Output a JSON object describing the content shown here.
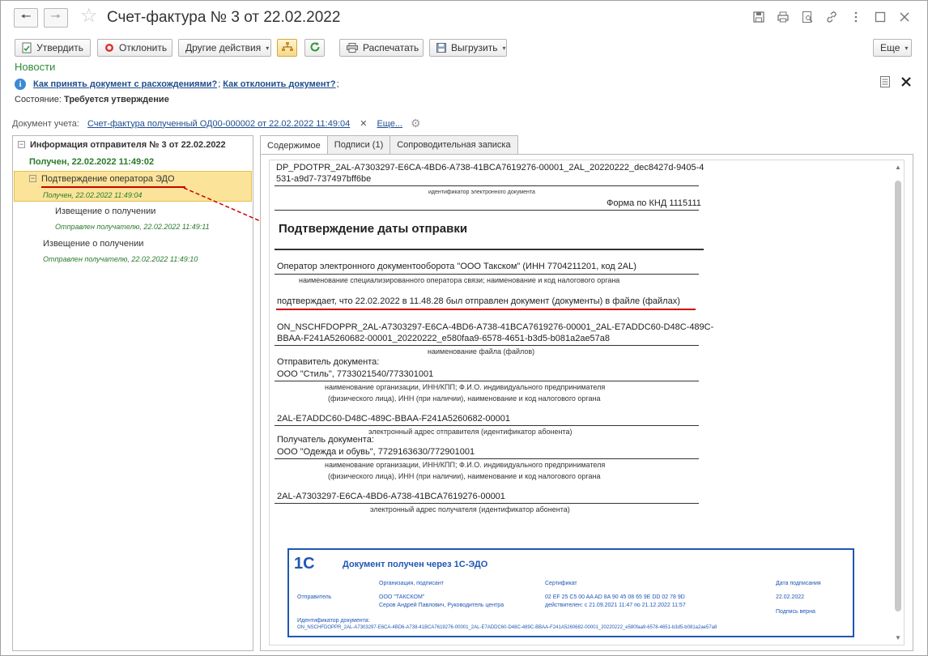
{
  "window": {
    "title": "Счет-фактура № 3 от 22.02.2022"
  },
  "toolbar": {
    "approve": "Утвердить",
    "reject": "Отклонить",
    "other_actions": "Другие действия",
    "print": "Распечатать",
    "export": "Выгрузить",
    "more": "Еще"
  },
  "news": "Новости",
  "info": {
    "link1": "Как принять документ с расхождениями?",
    "link2": "Как отклонить документ?",
    "sep1": ";",
    "sep2": ";"
  },
  "state": {
    "label": "Состояние:",
    "value": "Требуется утверждение"
  },
  "docline": {
    "label": "Документ учета:",
    "link": "Счет-фактура полученный ОД00-000002 от 22.02.2022 11:49:04",
    "more": "Еще..."
  },
  "tree": {
    "root": "Информация отправителя № 3 от 22.02.2022",
    "root_status": "Получен, 22.02.2022 11:49:02",
    "item1": "Подтверждение оператора ЭДО",
    "item1_status": "Получен, 22.02.2022 11:49:04",
    "item1_child": "Извещение о получении",
    "item1_child_status": "Отправлен получателю, 22.02.2022 11:49:11",
    "item2": "Извещение о получении",
    "item2_status": "Отправлен получателю, 22.02.2022 11:49:10"
  },
  "tabs": [
    "Содержимое",
    "Подписи (1)",
    "Сопроводительная записка"
  ],
  "doc": {
    "file_id_1": "DP_PDOTPR_2AL-A7303297-E6CA-4BD6-A738-41BCA7619276-00001_2AL_20220222_dec8427d-9405-4",
    "file_id_2": "531-a9d7-737497bff6be",
    "file_id_caption": "идентификатор электронного документа",
    "form": "Форма по КНД 1115111",
    "heading": "Подтверждение даты отправки",
    "operator": "Оператор электронного документооборота \"ООО Такском\" (ИНН 7704211201, код 2AL)",
    "operator_caption": "наименование специализированного оператора связи; наименование и код налогового органа",
    "confirms": "подтверждает, что 22.02.2022 в 11.48.28 был отправлен документ (документы) в файле (файлах)",
    "file_name_1": "ON_NSCHFDOPPR_2AL-A7303297-E6CA-4BD6-A738-41BCA7619276-00001_2AL-E7ADDC60-D48C-489C-",
    "file_name_2": "BBAA-F241A5260682-00001_20220222_e580faa9-6578-4651-b3d5-b081a2ae57a8",
    "file_name_caption": "наименование файла (файлов)",
    "sender_label": "Отправитель документа:",
    "sender": "ООО \"Стиль\", 7733021540/773301001",
    "org_caption_1": "наименование организации, ИНН/КПП; Ф.И.О. индивидуального предпринимателя",
    "org_caption_2": "(физического лица), ИНН (при наличии), наименование и код налогового органа",
    "sender_address": "2AL-E7ADDC60-D48C-489C-BBAA-F241A5260682-00001",
    "sender_address_caption": "электронный адрес отправителя (идентификатор абонента)",
    "receiver_label": "Получатель документа:",
    "receiver": "ООО \"Одежда и обувь\", 7729163630/772901001",
    "receiver_address": "2AL-A7303297-E6CA-4BD6-A738-41BCA7619276-00001",
    "receiver_address_caption": "электронный адрес получателя (идентификатор абонента)"
  },
  "stamp": {
    "logo": "1С",
    "title": "Документ получен через 1С-ЭДО",
    "col_org": "Организация, подписант",
    "col_cert": "Сертификат",
    "col_date": "Дата подписания",
    "row_label": "Отправитель",
    "org": "ООО \"ТАКСКОМ\"",
    "signer": "Серов Андрей Павлович, Руководитель центра",
    "cert": "02 EF 25 C5 00 AA AD 8A 90 45 08 65 9E DD 02 78 9D",
    "cert_valid": "действителен: с 21.09.2021 11:47 по 21.12.2022 11:57",
    "date": "22.02.2022",
    "sig_ok": "Подпись верна",
    "id_label": "Идентификатор документа:",
    "id": "ON_NSCHFDOPPR_2AL-A7303297-E6CA-4BD6-A738-41BCA7619276-00001_2AL-E7ADDC60-D48C-489C-BBAA-F241A5260682-00001_20220222_e580faa9-6578-4651-b3d5-b081a2ae57a8"
  },
  "colors": {
    "accent_green": "#2a7a2a",
    "link_blue": "#1f4e8c",
    "selection": "#fbe49a",
    "stamp_blue": "#1f57b5",
    "annotation_red": "#cc0000"
  }
}
